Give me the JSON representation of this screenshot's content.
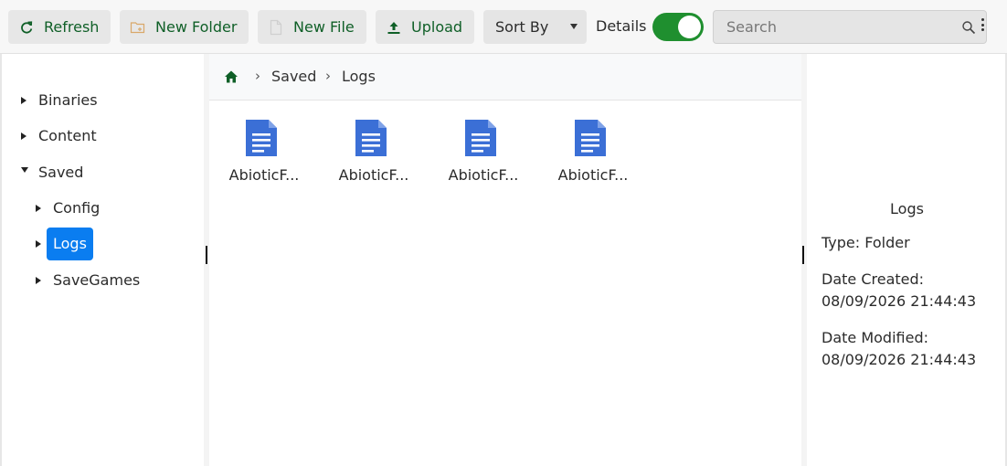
{
  "toolbar": {
    "refresh_label": "Refresh",
    "new_folder_label": "New Folder",
    "new_file_label": "New File",
    "upload_label": "Upload",
    "sort_by_label": "Sort By",
    "details_label": "Details",
    "details_on": true,
    "search_placeholder": "Search"
  },
  "tree": {
    "items": [
      {
        "label": "Binaries",
        "expanded": false
      },
      {
        "label": "Content",
        "expanded": false
      },
      {
        "label": "Saved",
        "expanded": true
      },
      {
        "label": "Config",
        "expanded": false
      },
      {
        "label": "Logs",
        "expanded": false,
        "selected": true
      },
      {
        "label": "SaveGames",
        "expanded": false
      }
    ]
  },
  "breadcrumb": {
    "items": [
      "Saved",
      "Logs"
    ],
    "separator": "›"
  },
  "files": [
    {
      "name": "AbioticF...",
      "icon": "document-icon"
    },
    {
      "name": "AbioticF...",
      "icon": "document-icon"
    },
    {
      "name": "AbioticF...",
      "icon": "document-icon"
    },
    {
      "name": "AbioticF...",
      "icon": "document-icon"
    }
  ],
  "details": {
    "title": "Logs",
    "type": "Type: Folder",
    "created_label": "Date Created:",
    "created_value": "08/09/2026 21:44:43",
    "modified_label": "Date Modified:",
    "modified_value": "08/09/2026 21:44:43"
  },
  "colors": {
    "accent_green": "#1f8f2f",
    "selection_blue": "#0a7df0",
    "file_icon_blue": "#3b6fd6"
  }
}
